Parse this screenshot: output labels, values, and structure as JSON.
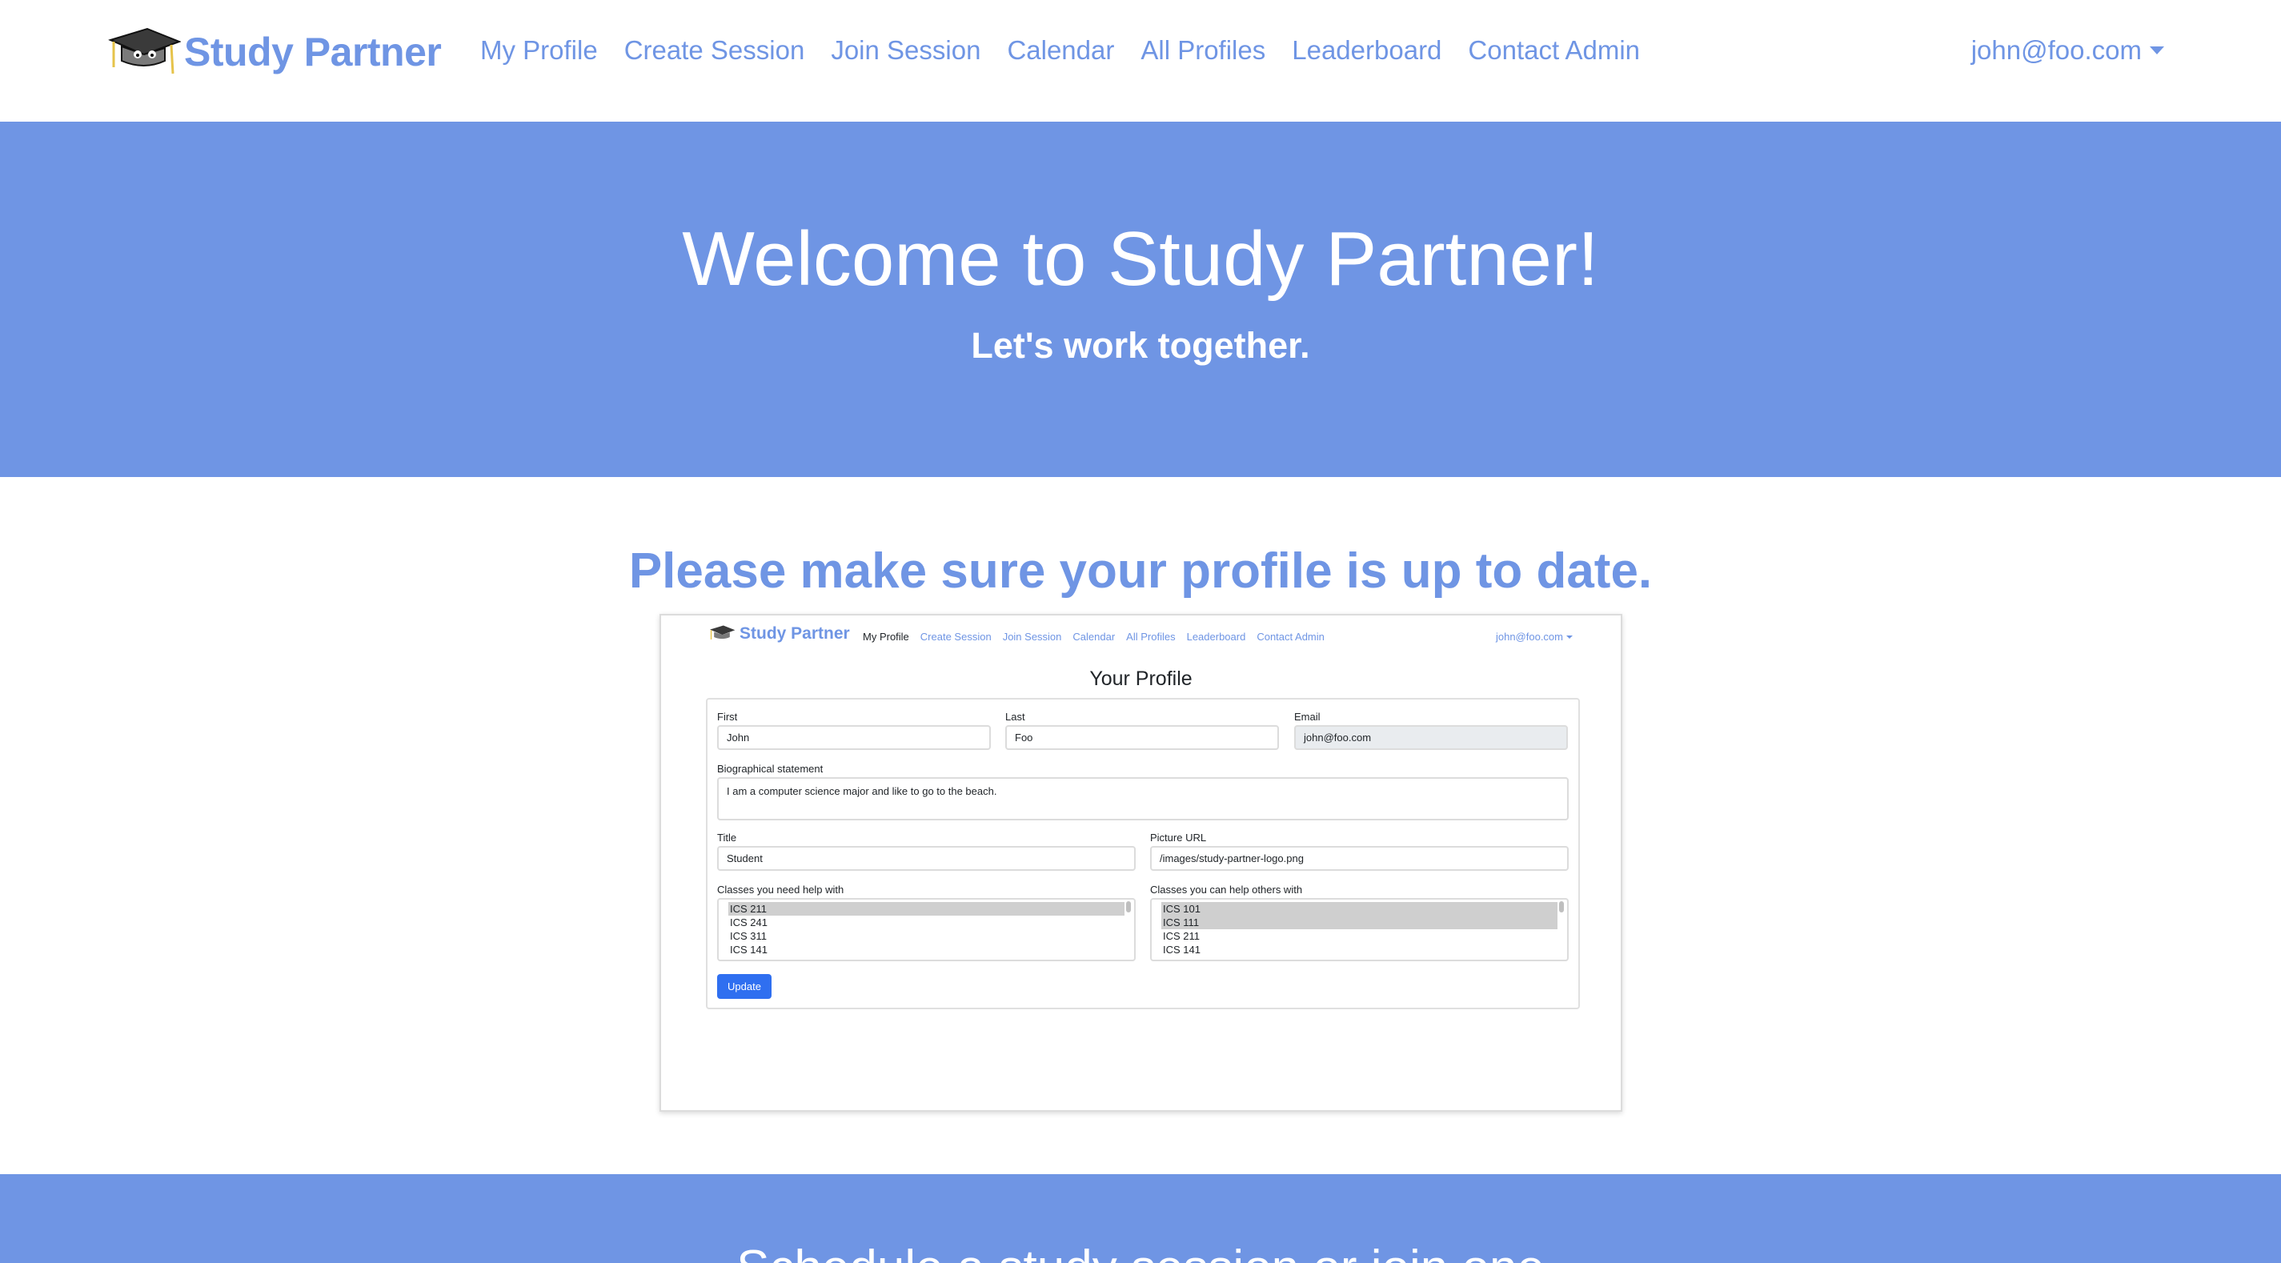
{
  "navbar": {
    "brand": "Study Partner",
    "links": [
      "My Profile",
      "Create Session",
      "Join Session",
      "Calendar",
      "All Profiles",
      "Leaderboard",
      "Contact Admin"
    ],
    "user": "john@foo.com"
  },
  "hero": {
    "title": "Welcome to Study Partner!",
    "subtitle": "Let's work together."
  },
  "profile_section": {
    "title": "Please make sure your profile is up to date."
  },
  "screenshot": {
    "brand": "Study Partner",
    "links": [
      "My Profile",
      "Create Session",
      "Join Session",
      "Calendar",
      "All Profiles",
      "Leaderboard",
      "Contact Admin"
    ],
    "user": "john@foo.com",
    "heading": "Your Profile",
    "form": {
      "first_label": "First",
      "first_value": "John",
      "last_label": "Last",
      "last_value": "Foo",
      "email_label": "Email",
      "email_value": "john@foo.com",
      "bio_label": "Biographical statement",
      "bio_value": "I am a computer science major and like to go to the beach.",
      "title_label": "Title",
      "title_value": "Student",
      "picture_label": "Picture URL",
      "picture_value": "/images/study-partner-logo.png",
      "need_label": "Classes you need help with",
      "need_options": [
        "ICS 211",
        "ICS 241",
        "ICS 311",
        "ICS 141"
      ],
      "help_label": "Classes you can help others with",
      "help_options": [
        "ICS 101",
        "ICS 111",
        "ICS 211",
        "ICS 141"
      ],
      "update_label": "Update"
    }
  },
  "schedule_section": {
    "title": "Schedule a study session or join one"
  },
  "colors": {
    "brand_blue": "#6f95e4",
    "button_blue": "#2f6ff0"
  }
}
